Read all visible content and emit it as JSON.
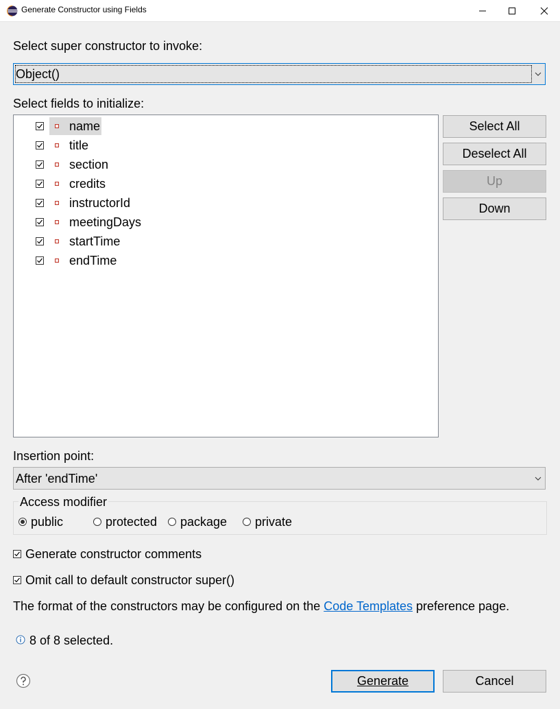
{
  "window": {
    "title": "Generate Constructor using Fields",
    "controls": [
      "minimize",
      "maximize",
      "close"
    ],
    "app_icon": "eclipse-icon"
  },
  "super_constructor": {
    "label": "Select super constructor to invoke:",
    "value": "Object()"
  },
  "fields": {
    "label": "Select fields to initialize:",
    "items": [
      {
        "name": "name",
        "checked": true,
        "selected": true
      },
      {
        "name": "title",
        "checked": true
      },
      {
        "name": "section",
        "checked": true
      },
      {
        "name": "credits",
        "checked": true
      },
      {
        "name": "instructorId",
        "checked": true
      },
      {
        "name": "meetingDays",
        "checked": true
      },
      {
        "name": "startTime",
        "checked": true
      },
      {
        "name": "endTime",
        "checked": true
      }
    ],
    "field_icon": "private-field-icon"
  },
  "buttons": {
    "select_all": "Select All",
    "deselect_all": "Deselect All",
    "up": "Up",
    "down": "Down",
    "generate": "Generate",
    "cancel": "Cancel"
  },
  "insertion": {
    "label": "Insertion point:",
    "value": "After 'endTime'"
  },
  "access_modifier": {
    "title": "Access modifier",
    "options": [
      "public",
      "protected",
      "package",
      "private"
    ],
    "selected": "public"
  },
  "options": {
    "generate_comments": {
      "label": "Generate constructor comments",
      "checked": true
    },
    "omit_super": {
      "label": "Omit call to default constructor super()",
      "checked": true
    }
  },
  "info": {
    "text_before": "The format of the constructors may be configured on the ",
    "link": "Code Templates",
    "text_after": " preference page."
  },
  "status": {
    "text": "8 of 8 selected.",
    "icon": "info-icon"
  },
  "help": {
    "icon": "help-icon"
  },
  "colors": {
    "accent": "#0078d7",
    "link": "#0066cc",
    "background": "#f0f0f0"
  }
}
